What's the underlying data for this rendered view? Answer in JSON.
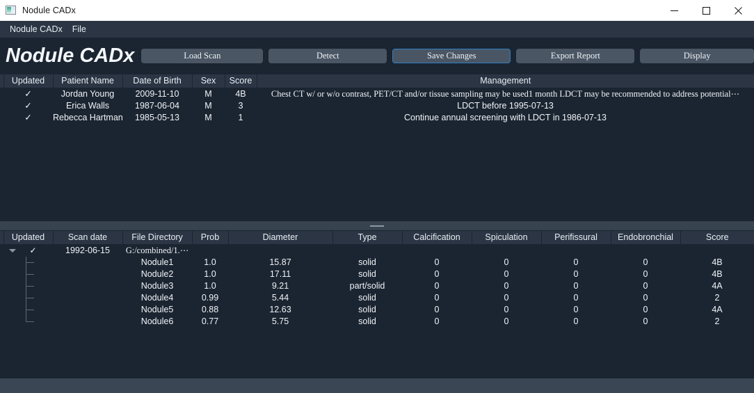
{
  "window": {
    "title": "Nodule CADx",
    "app_icon": "picture-icon",
    "controls": {
      "minimize": "minimize-icon",
      "maximize": "maximize-icon",
      "close": "close-icon"
    }
  },
  "menubar": {
    "items": [
      "Nodule CADx",
      "File"
    ]
  },
  "toolbar": {
    "brand": "Nodule CADx",
    "buttons": [
      {
        "label": "Load Scan",
        "focused": false
      },
      {
        "label": "Detect",
        "focused": false
      },
      {
        "label": "Save Changes",
        "focused": true
      },
      {
        "label": "Export Report",
        "focused": false
      },
      {
        "label": "Display",
        "focused": false
      }
    ],
    "focus_color": "#2f7fc4"
  },
  "patient_table": {
    "columns": [
      "Updated",
      "Patient Name",
      "Date of Birth",
      "Sex",
      "Score",
      "Management"
    ],
    "rows": [
      {
        "updated": "✓",
        "patient_name": "Jordan Young",
        "date_of_birth": "2009-11-10",
        "sex": "M",
        "score": "4B",
        "management": "Chest CT w/ or w/o contrast, PET/CT and/or tissue sampling may be used1 month LDCT may be recommended to address potential⋯"
      },
      {
        "updated": "✓",
        "patient_name": "Erica Walls",
        "date_of_birth": "1987-06-04",
        "sex": "M",
        "score": "3",
        "management": "LDCT before 1995-07-13"
      },
      {
        "updated": "✓",
        "patient_name": "Rebecca Hartman",
        "date_of_birth": "1985-05-13",
        "sex": "M",
        "score": "1",
        "management": "Continue annual screening with LDCT in 1986-07-13"
      }
    ]
  },
  "splitter": {
    "handle": "splitter-grip"
  },
  "nodule_table": {
    "columns": [
      "Updated",
      "Scan date",
      "File Directory",
      "Prob",
      "Diameter",
      "Type",
      "Calcification",
      "Spiculation",
      "Perifissural",
      "Endobronchial",
      "Score"
    ],
    "scan_row": {
      "expander": "▼",
      "updated": "✓",
      "scan_date": "1992-06-15",
      "file_directory": "G:/combined/1.⋯"
    },
    "nodules": [
      {
        "name": "Nodule1",
        "prob": "1.0",
        "diameter": "15.87",
        "type": "solid",
        "calcification": "0",
        "spiculation": "0",
        "perifissural": "0",
        "endobronchial": "0",
        "score": "4B"
      },
      {
        "name": "Nodule2",
        "prob": "1.0",
        "diameter": "17.11",
        "type": "solid",
        "calcification": "0",
        "spiculation": "0",
        "perifissural": "0",
        "endobronchial": "0",
        "score": "4B"
      },
      {
        "name": "Nodule3",
        "prob": "1.0",
        "diameter": "9.21",
        "type": "part/solid",
        "calcification": "0",
        "spiculation": "0",
        "perifissural": "0",
        "endobronchial": "0",
        "score": "4A"
      },
      {
        "name": "Nodule4",
        "prob": "0.99",
        "diameter": "5.44",
        "type": "solid",
        "calcification": "0",
        "spiculation": "0",
        "perifissural": "0",
        "endobronchial": "0",
        "score": "2"
      },
      {
        "name": "Nodule5",
        "prob": "0.88",
        "diameter": "12.63",
        "type": "solid",
        "calcification": "0",
        "spiculation": "0",
        "perifissural": "0",
        "endobronchial": "0",
        "score": "4A"
      },
      {
        "name": "Nodule6",
        "prob": "0.77",
        "diameter": "5.75",
        "type": "solid",
        "calcification": "0",
        "spiculation": "0",
        "perifissural": "0",
        "endobronchial": "0",
        "score": "2"
      }
    ]
  },
  "colors": {
    "window_bg": "#1b2531",
    "header_bg": "#2b3544",
    "button_bg": "#4a5663",
    "text": "#f0f3f7",
    "splitter": "#37434f",
    "statusbar": "#3a4654"
  }
}
